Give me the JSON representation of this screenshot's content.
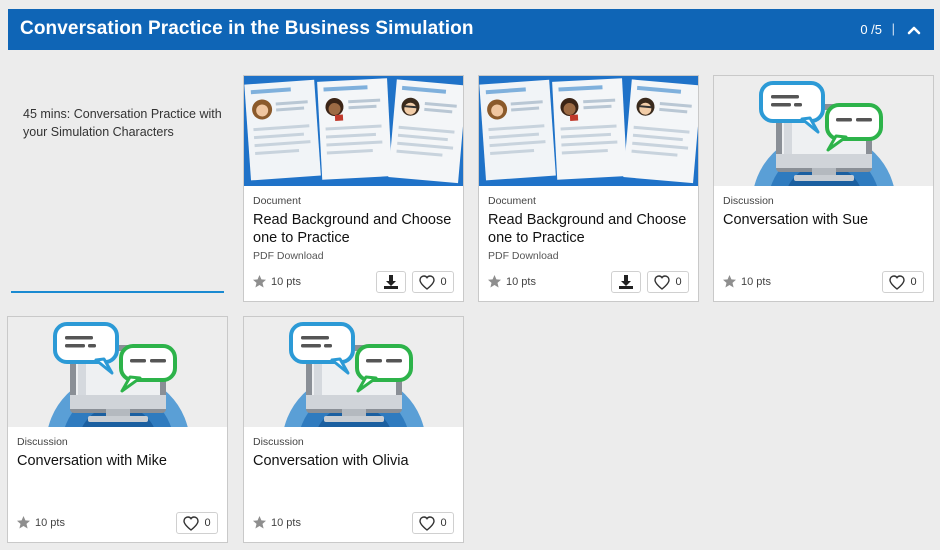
{
  "header": {
    "title": "Conversation Practice in the Business Simulation",
    "progress": "0 /5",
    "separator": "|"
  },
  "intro": {
    "text": "45 mins: Conversation Practice with your Simulation Characters"
  },
  "cards": [
    {
      "type": "Document",
      "title": "Read Background and Choose one to Practice",
      "subtitle": "PDF Download",
      "points": "10 pts",
      "likes": "0",
      "thumbnail": "resume-documents-image"
    },
    {
      "type": "Document",
      "title": "Read Background and Choose one to Practice",
      "subtitle": "PDF Download",
      "points": "10 pts",
      "likes": "0",
      "thumbnail": "resume-documents-image"
    },
    {
      "type": "Discussion",
      "title": "Conversation with Sue",
      "subtitle": "",
      "points": "10 pts",
      "likes": "0",
      "thumbnail": "monitor-chat-bubbles-image"
    },
    {
      "type": "Discussion",
      "title": "Conversation with Mike",
      "subtitle": "",
      "points": "10 pts",
      "likes": "0",
      "thumbnail": "monitor-chat-bubbles-image"
    },
    {
      "type": "Discussion",
      "title": "Conversation with Olivia",
      "subtitle": "",
      "points": "10 pts",
      "likes": "0",
      "thumbnail": "monitor-chat-bubbles-image"
    }
  ],
  "colors": {
    "header": "#0f65b6",
    "accent": "#1a8ad1",
    "chat_blue": "#2c9ad6",
    "chat_green": "#2db34a"
  }
}
